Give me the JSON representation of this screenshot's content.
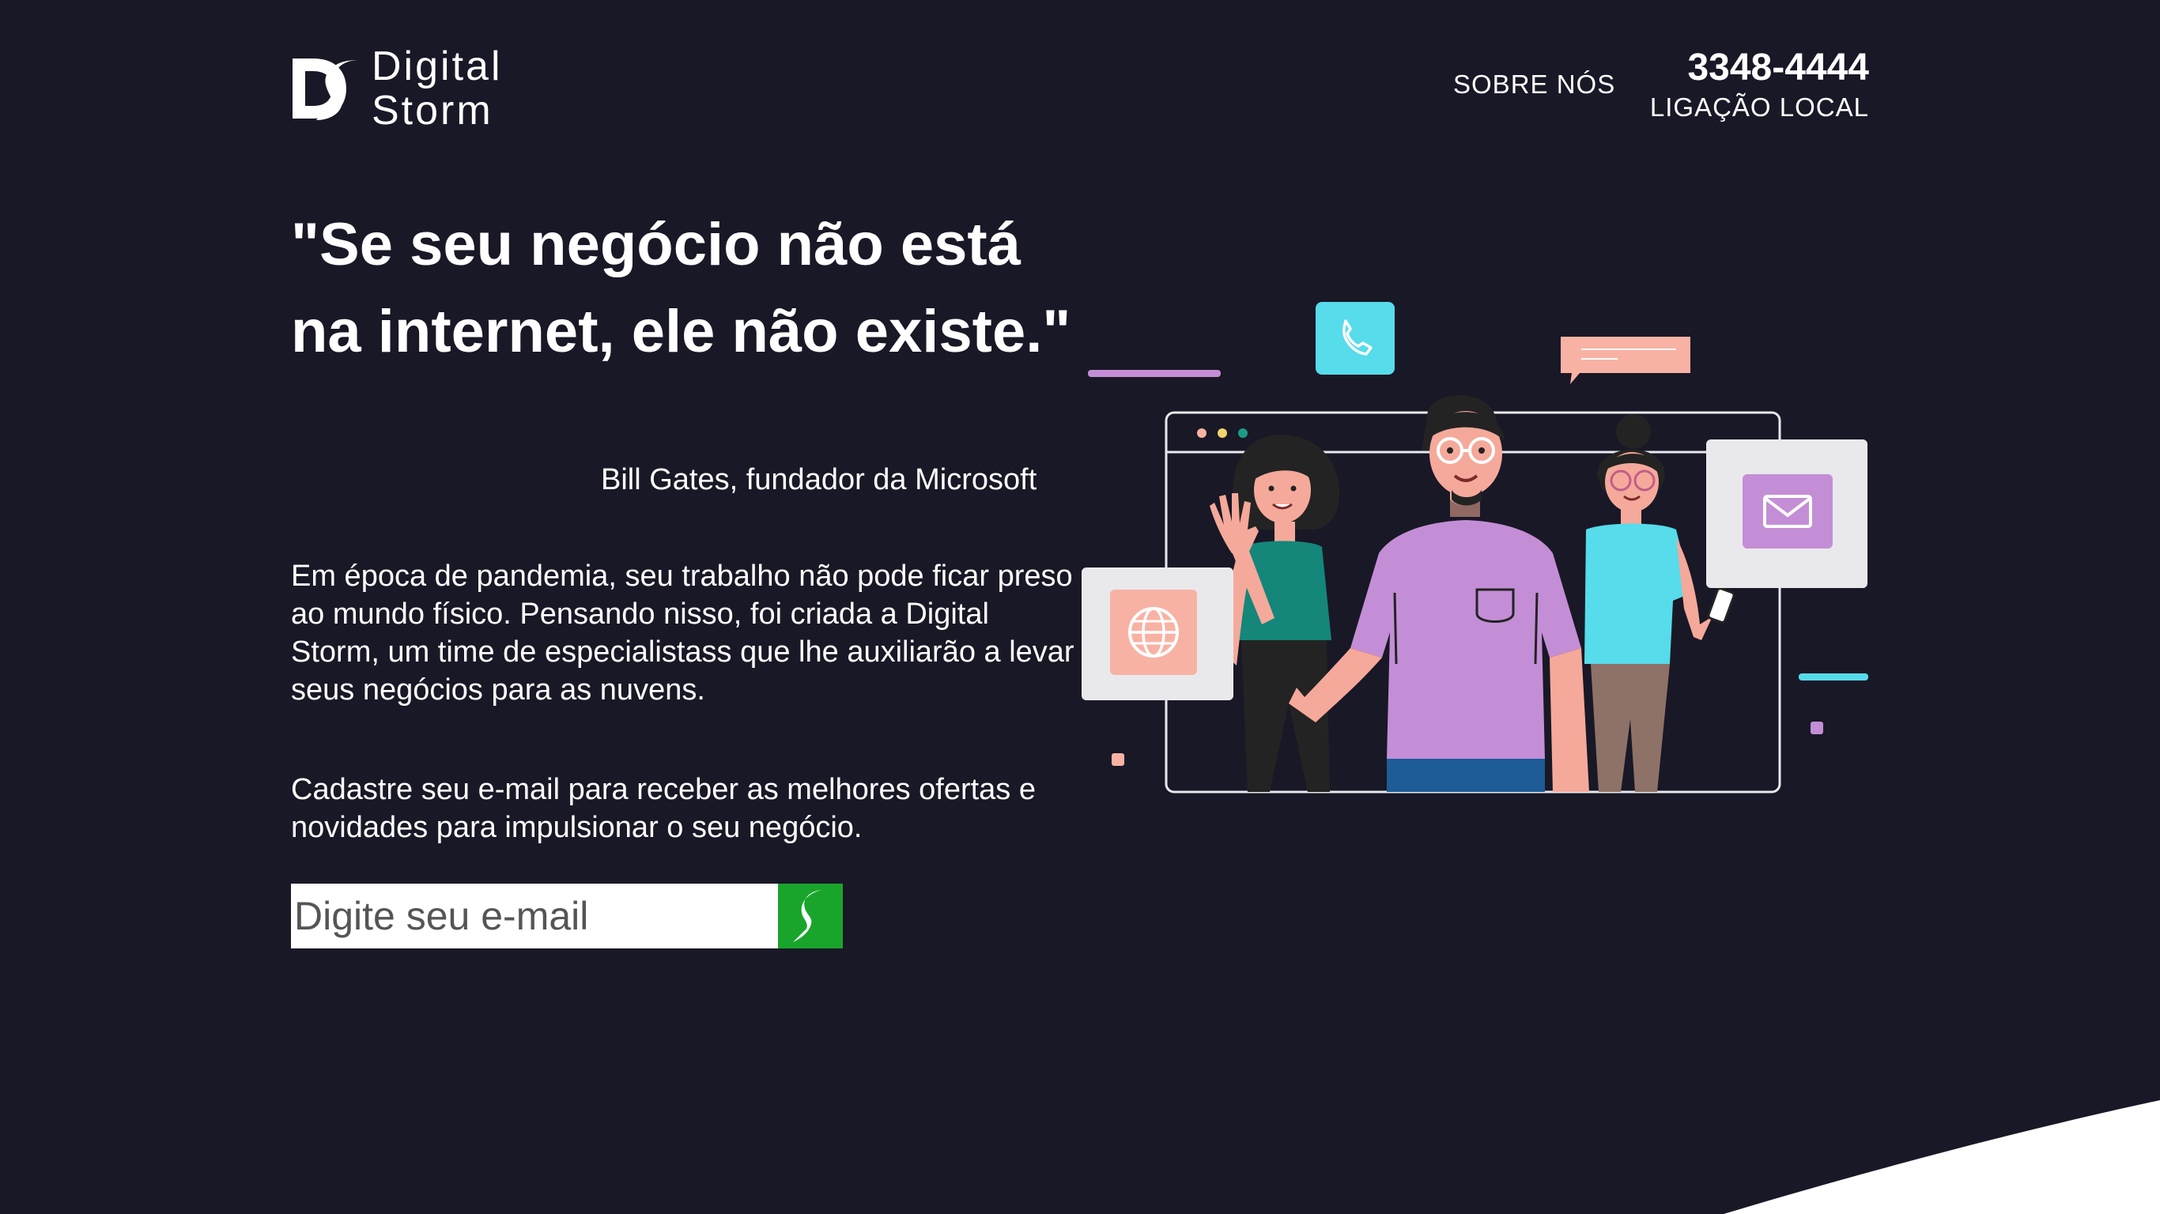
{
  "header": {
    "logo_line1": "Digital",
    "logo_line2": "Storm",
    "nav_about": "SOBRE NÓS",
    "phone_number": "3348-4444",
    "phone_label": "LIGAÇÃO LOCAL"
  },
  "hero": {
    "quote": "\"Se seu negócio não está na internet, ele não existe.\"",
    "author": "Bill Gates, fundador da Microsoft",
    "intro": "Em época de pandemia, seu trabalho não pode ficar preso ao mundo físico. Pensando nisso, foi criada a Digital Storm, um time de especialistass que lhe auxiliarão a levar seus negócios para as nuvens.",
    "cta": "Cadastre seu e-mail para receber as melhores ofertas e novidades para impulsionar o seu negócio."
  },
  "form": {
    "email_placeholder": "Digite seu e-mail",
    "submit_icon": "lightning-icon"
  },
  "illustration": {
    "icons": [
      "phone-icon",
      "chat-bubble-icon",
      "globe-icon",
      "mail-icon"
    ],
    "people": [
      "woman-teal-shirt",
      "man-purple-shirt",
      "woman-blue-shirt"
    ]
  },
  "colors": {
    "background": "#191826",
    "accent_green": "#19a52b",
    "accent_cyan": "#56dcea",
    "accent_salmon": "#f8b2a4",
    "accent_purple": "#c48ed6"
  }
}
